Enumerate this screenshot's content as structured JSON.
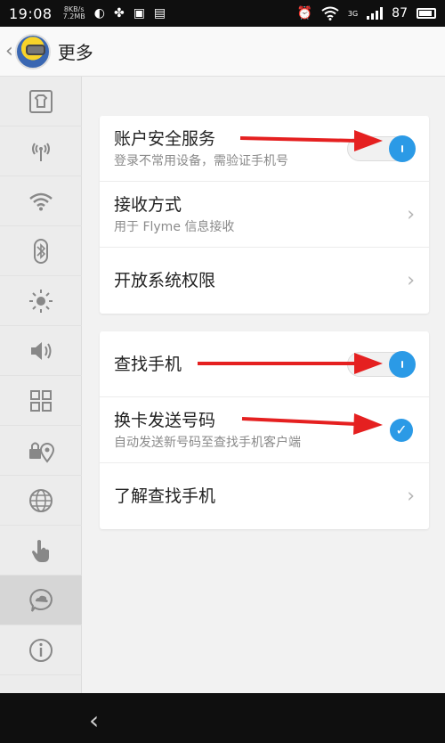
{
  "statusbar": {
    "time": "19:08",
    "net_speed_top": "8KB/s",
    "net_speed_bottom": "7.2MB",
    "network_label": "3G",
    "battery": "87",
    "icons": [
      "wechat-icon",
      "pinwheel-icon",
      "image-icon",
      "app-icon",
      "alarm-icon",
      "wifi-icon",
      "signal-icon",
      "battery-icon"
    ]
  },
  "header": {
    "title": "更多",
    "back_icon": "chevron-left-icon",
    "avatar_icon": "minion-avatar"
  },
  "sidebar": {
    "items": [
      {
        "icon": "home-shirt-icon"
      },
      {
        "icon": "antenna-icon"
      },
      {
        "icon": "wifi-icon"
      },
      {
        "icon": "bluetooth-icon"
      },
      {
        "icon": "brightness-icon"
      },
      {
        "icon": "volume-icon"
      },
      {
        "icon": "apps-grid-icon"
      },
      {
        "icon": "lock-location-icon"
      },
      {
        "icon": "globe-icon"
      },
      {
        "icon": "touch-hand-icon"
      },
      {
        "icon": "cloud-chat-icon",
        "active": true
      },
      {
        "icon": "info-icon"
      }
    ]
  },
  "card1": {
    "account_security": {
      "title": "账户安全服务",
      "subtitle": "登录不常用设备，需验证手机号",
      "enabled": true
    },
    "receive_method": {
      "title": "接收方式",
      "subtitle": "用于 Flyme 信息接收"
    },
    "system_permissions": {
      "title": "开放系统权限"
    }
  },
  "card2": {
    "find_phone": {
      "title": "查找手机",
      "enabled": true
    },
    "sim_change": {
      "title": "换卡发送号码",
      "subtitle": "自动发送新号码至查找手机客户端",
      "checked": true
    },
    "learn_find_phone": {
      "title": "了解查找手机"
    }
  },
  "colors": {
    "accent": "#2b9ae6",
    "annotation_arrow": "#e52020"
  }
}
